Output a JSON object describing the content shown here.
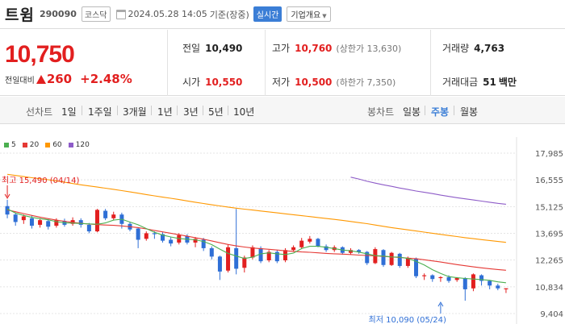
{
  "header": {
    "name": "트윔",
    "code": "290090",
    "market": "코스닥",
    "datetime": "2024.05.28 14:05",
    "basis": "기준(장중)",
    "live_label": "실시간",
    "info_label": "기업개요"
  },
  "quote": {
    "price": "10,750",
    "change_label": "전일대비",
    "change": "260",
    "change_pct": "+2.48%",
    "prev_label": "전일",
    "prev": "10,490",
    "open_label": "시가",
    "open": "10,550",
    "high_label": "고가",
    "high": "10,760",
    "upper_limit": "(상한가 13,630)",
    "low_label": "저가",
    "low": "10,500",
    "lower_limit": "(하한가 7,350)",
    "volume_label": "거래량",
    "volume": "4,763",
    "amount_label": "거래대금",
    "amount": "51",
    "amount_unit": "백만",
    "up_color": "#e21f1f",
    "down_color": "#2f6fd6"
  },
  "tabs": {
    "line_label": "선차트",
    "line_periods": [
      "1일",
      "1주일",
      "3개월",
      "1년",
      "3년",
      "5년",
      "10년"
    ],
    "candle_label": "봉차트",
    "candle_periods": [
      "일봉",
      "주봉",
      "월봉"
    ],
    "selected": "주봉"
  },
  "chart_data": {
    "type": "candlestick",
    "legend": [
      {
        "label": "5",
        "color": "#4caf50"
      },
      {
        "label": "20",
        "color": "#e53935"
      },
      {
        "label": "60",
        "color": "#ff9800"
      },
      {
        "label": "120",
        "color": "#8e5cc8"
      }
    ],
    "y_ticks": [
      "17,985",
      "16,555",
      "15,125",
      "13,695",
      "12,265",
      "10,834",
      "9,404"
    ],
    "ylim": [
      9404,
      17985
    ],
    "high_note": "최고 15,490 (04/14)",
    "low_note": "최저 10,090 (05/24)",
    "high_point": {
      "index": 0,
      "value": 15490
    },
    "low_point": {
      "index": 53,
      "value": 10090
    },
    "candles": [
      [
        15150,
        14700,
        15490,
        14500
      ],
      [
        14700,
        14300,
        14800,
        14100
      ],
      [
        14400,
        14600,
        14700,
        14200
      ],
      [
        14500,
        14100,
        14650,
        13950
      ],
      [
        14150,
        14400,
        14500,
        14000
      ],
      [
        14350,
        14050,
        14450,
        13900
      ],
      [
        14100,
        14400,
        14500,
        14000
      ],
      [
        14350,
        14150,
        14480,
        14050
      ],
      [
        14200,
        14400,
        14550,
        14100
      ],
      [
        14400,
        14150,
        14500,
        14000
      ],
      [
        14150,
        13800,
        14250,
        13700
      ],
      [
        13800,
        14950,
        15000,
        13750
      ],
      [
        14900,
        14500,
        15000,
        14400
      ],
      [
        14500,
        14700,
        14850,
        14400
      ],
      [
        14700,
        14200,
        14800,
        13950
      ],
      [
        14200,
        13900,
        14300,
        13800
      ],
      [
        13950,
        13350,
        14000,
        12900
      ],
      [
        13400,
        13700,
        13800,
        13300
      ],
      [
        13700,
        13650,
        13800,
        13400
      ],
      [
        13650,
        13300,
        13750,
        13200
      ],
      [
        13350,
        13150,
        13500,
        13000
      ],
      [
        13200,
        13600,
        13700,
        13100
      ],
      [
        13550,
        13200,
        13650,
        13100
      ],
      [
        13200,
        13400,
        13500,
        12950
      ],
      [
        13350,
        12900,
        13450,
        12750
      ],
      [
        12900,
        12450,
        13000,
        12300
      ],
      [
        12450,
        11650,
        12500,
        11200
      ],
      [
        11700,
        12950,
        13100,
        11600
      ],
      [
        12900,
        11800,
        15000,
        11500
      ],
      [
        11850,
        12400,
        12500,
        11600
      ],
      [
        12400,
        12950,
        13050,
        12300
      ],
      [
        12900,
        12200,
        13000,
        12100
      ],
      [
        12250,
        12700,
        12800,
        12150
      ],
      [
        12700,
        12200,
        12800,
        12100
      ],
      [
        12250,
        12800,
        12900,
        12150
      ],
      [
        12800,
        12950,
        13050,
        12700
      ],
      [
        12950,
        13300,
        13450,
        12850
      ],
      [
        13250,
        13400,
        13550,
        13150
      ],
      [
        13400,
        13000,
        13450,
        12950
      ],
      [
        13000,
        12800,
        13100,
        12700
      ],
      [
        12800,
        12950,
        13050,
        12700
      ],
      [
        12950,
        12650,
        13000,
        12550
      ],
      [
        12650,
        12800,
        12900,
        12550
      ],
      [
        12800,
        12700,
        12850,
        12600
      ],
      [
        12700,
        12100,
        12750,
        12000
      ],
      [
        12100,
        12850,
        12950,
        12050
      ],
      [
        12800,
        12000,
        12850,
        11900
      ],
      [
        12000,
        12650,
        12700,
        11950
      ],
      [
        12600,
        11950,
        12650,
        11850
      ],
      [
        11950,
        12350,
        12450,
        11850
      ],
      [
        12350,
        11400,
        12400,
        11300
      ],
      [
        11400,
        11450,
        11550,
        11200
      ],
      [
        11450,
        11250,
        11500,
        11100
      ],
      [
        11300,
        11350,
        11400,
        11100
      ],
      [
        11350,
        11150,
        11450,
        11050
      ],
      [
        11200,
        11300,
        11350,
        11100
      ],
      [
        11300,
        10700,
        11350,
        10090
      ],
      [
        10750,
        11500,
        11550,
        10600
      ],
      [
        11450,
        11150,
        11500,
        10900
      ],
      [
        11150,
        10900,
        11200,
        10700
      ],
      [
        10900,
        10750,
        11000,
        10650
      ],
      [
        10700,
        10750,
        10760,
        10500
      ]
    ],
    "ma5": [
      15000,
      14780,
      14650,
      14550,
      14480,
      14420,
      14320,
      14260,
      14240,
      14220,
      14200,
      14180,
      14250,
      14400,
      14450,
      14300,
      14150,
      13950,
      13750,
      13600,
      13500,
      13420,
      13380,
      13350,
      13260,
      13090,
      12850,
      12620,
      12480,
      12350,
      12420,
      12600,
      12650,
      12600,
      12560,
      12640,
      12880,
      13000,
      13000,
      12950,
      12880,
      12800,
      12760,
      12690,
      12600,
      12500,
      12480,
      12430,
      12420,
      12350,
      12200,
      12000,
      11750,
      11550,
      11380,
      11320,
      11280,
      11250,
      11220,
      11180,
      11100,
      11050
    ],
    "ma20": [
      14950,
      14850,
      14750,
      14650,
      14560,
      14480,
      14400,
      14340,
      14280,
      14230,
      14190,
      14160,
      14140,
      14120,
      14090,
      14050,
      14000,
      13930,
      13850,
      13770,
      13700,
      13620,
      13540,
      13460,
      13380,
      13290,
      13190,
      13100,
      13020,
      12960,
      12910,
      12870,
      12840,
      12800,
      12760,
      12730,
      12700,
      12680,
      12650,
      12620,
      12600,
      12580,
      12560,
      12530,
      12510,
      12490,
      12460,
      12430,
      12400,
      12370,
      12330,
      12280,
      12220,
      12160,
      12090,
      12020,
      11960,
      11900,
      11850,
      11800,
      11760,
      11720
    ],
    "ma60": [
      16850,
      16790,
      16730,
      16670,
      16620,
      16560,
      16500,
      16430,
      16360,
      16290,
      16230,
      16170,
      16110,
      16050,
      15980,
      15910,
      15840,
      15770,
      15700,
      15630,
      15570,
      15500,
      15430,
      15360,
      15290,
      15220,
      15160,
      15100,
      15040,
      14990,
      14940,
      14890,
      14840,
      14790,
      14740,
      14690,
      14640,
      14590,
      14540,
      14490,
      14440,
      14390,
      14330,
      14270,
      14210,
      14140,
      14070,
      14000,
      13940,
      13880,
      13820,
      13760,
      13700,
      13640,
      13580,
      13520,
      13460,
      13410,
      13360,
      13310,
      13260,
      13210
    ],
    "ma120_start": 42,
    "ma120": [
      16700,
      16600,
      16480,
      16380,
      16290,
      16210,
      16120,
      16040,
      15960,
      15890,
      15820,
      15740,
      15670,
      15600,
      15540,
      15480,
      15420,
      15360,
      15300,
      15250
    ]
  }
}
